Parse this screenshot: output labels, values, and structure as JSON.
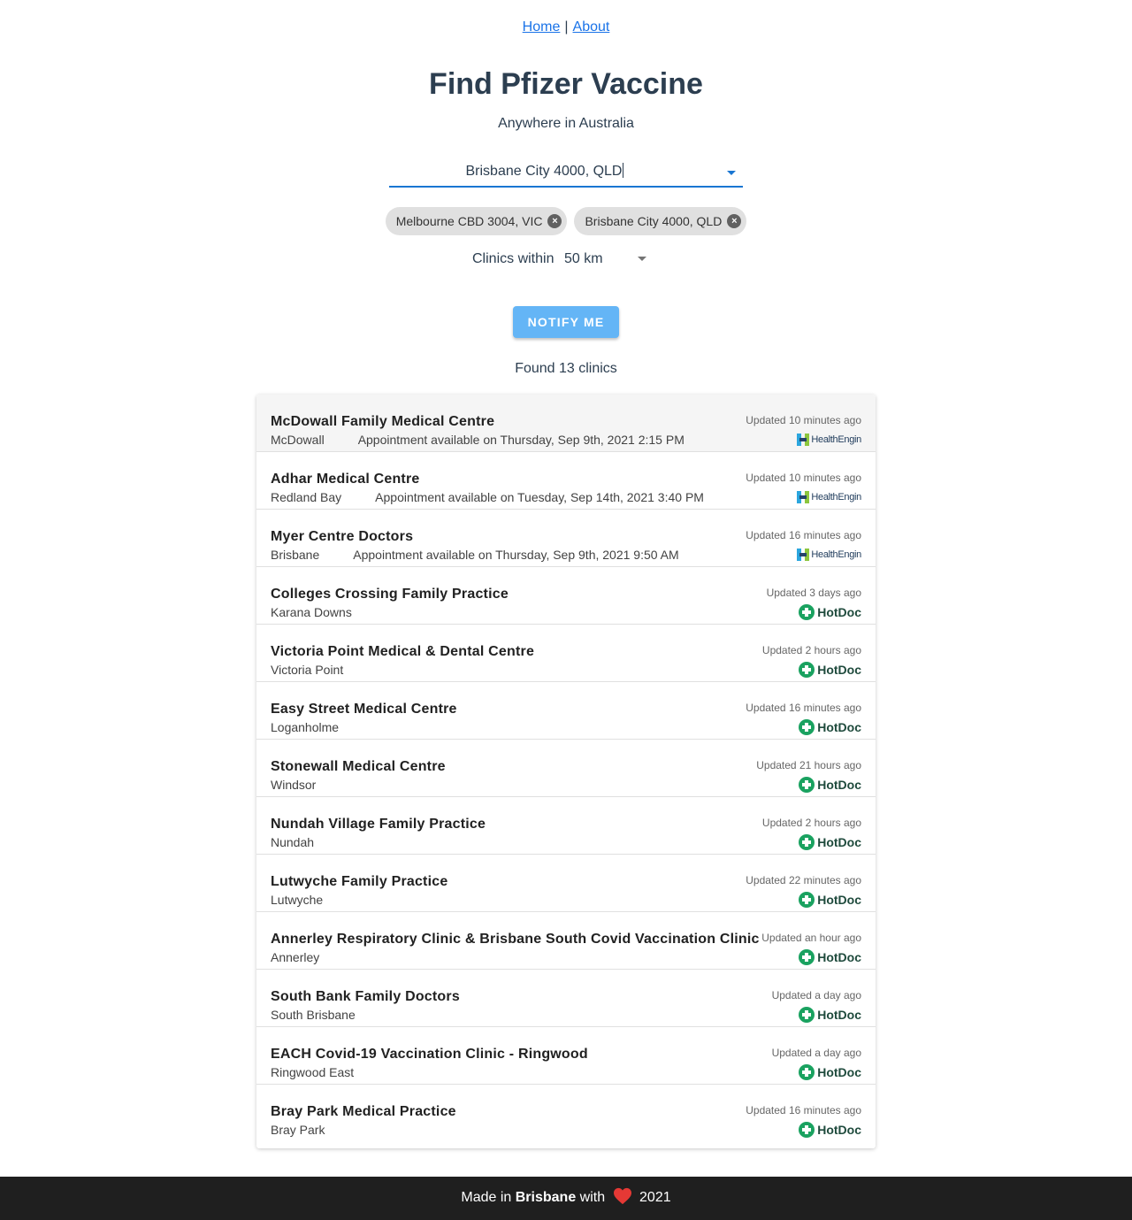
{
  "nav": {
    "home_label": "Home",
    "separator": "|",
    "about_label": "About"
  },
  "header": {
    "title": "Find Pfizer Vaccine",
    "subtitle": "Anywhere in Australia"
  },
  "search": {
    "location_value": "Brisbane City 4000, QLD",
    "chips": [
      "Melbourne CBD 3004, VIC",
      "Brisbane City 4000, QLD"
    ],
    "radius_label": "Clinics within",
    "radius_value": "50 km"
  },
  "notify_label": "NOTIFY ME",
  "results_summary": "Found 13 clinics",
  "providers": {
    "hotdoc": "HotDoc",
    "healthengine": "HealthEngin"
  },
  "clinics": [
    {
      "name": "McDowall Family Medical Centre",
      "suburb": "McDowall",
      "appointment": "Appointment available on Thursday, Sep 9th, 2021 2:15 PM",
      "updated": "Updated 10 minutes ago",
      "provider": "healthengine"
    },
    {
      "name": "Adhar Medical Centre",
      "suburb": "Redland Bay",
      "appointment": "Appointment available on Tuesday, Sep 14th, 2021 3:40 PM",
      "updated": "Updated 10 minutes ago",
      "provider": "healthengine"
    },
    {
      "name": "Myer Centre Doctors",
      "suburb": "Brisbane",
      "appointment": "Appointment available on Thursday, Sep 9th, 2021 9:50 AM",
      "updated": "Updated 16 minutes ago",
      "provider": "healthengine"
    },
    {
      "name": "Colleges Crossing Family Practice",
      "suburb": "Karana Downs",
      "appointment": "",
      "updated": "Updated 3 days ago",
      "provider": "hotdoc"
    },
    {
      "name": "Victoria Point Medical & Dental Centre",
      "suburb": "Victoria Point",
      "appointment": "",
      "updated": "Updated 2 hours ago",
      "provider": "hotdoc"
    },
    {
      "name": "Easy Street Medical Centre",
      "suburb": "Loganholme",
      "appointment": "",
      "updated": "Updated 16 minutes ago",
      "provider": "hotdoc"
    },
    {
      "name": "Stonewall Medical Centre",
      "suburb": "Windsor",
      "appointment": "",
      "updated": "Updated 21 hours ago",
      "provider": "hotdoc"
    },
    {
      "name": "Nundah Village Family Practice",
      "suburb": "Nundah",
      "appointment": "",
      "updated": "Updated 2 hours ago",
      "provider": "hotdoc"
    },
    {
      "name": "Lutwyche Family Practice",
      "suburb": "Lutwyche",
      "appointment": "",
      "updated": "Updated 22 minutes ago",
      "provider": "hotdoc"
    },
    {
      "name": "Annerley Respiratory Clinic & Brisbane South Covid Vaccination Clinic",
      "suburb": "Annerley",
      "appointment": "",
      "updated": "Updated an hour ago",
      "provider": "hotdoc"
    },
    {
      "name": "South Bank Family Doctors",
      "suburb": "South Brisbane",
      "appointment": "",
      "updated": "Updated a day ago",
      "provider": "hotdoc"
    },
    {
      "name": "EACH Covid-19 Vaccination Clinic - Ringwood",
      "suburb": "Ringwood East",
      "appointment": "",
      "updated": "Updated a day ago",
      "provider": "hotdoc"
    },
    {
      "name": "Bray Park Medical Practice",
      "suburb": "Bray Park",
      "appointment": "",
      "updated": "Updated 16 minutes ago",
      "provider": "hotdoc"
    }
  ],
  "footer": {
    "made_in": "Made in",
    "city": "Brisbane",
    "with": "with",
    "year": "2021",
    "heart_icon": "heart-icon",
    "heart_color": "#e53935"
  },
  "colors": {
    "accent": "#1976d2",
    "button": "#64b5f6",
    "hotdoc_green": "#1aa260",
    "footer_bg": "#1f1f1f"
  }
}
